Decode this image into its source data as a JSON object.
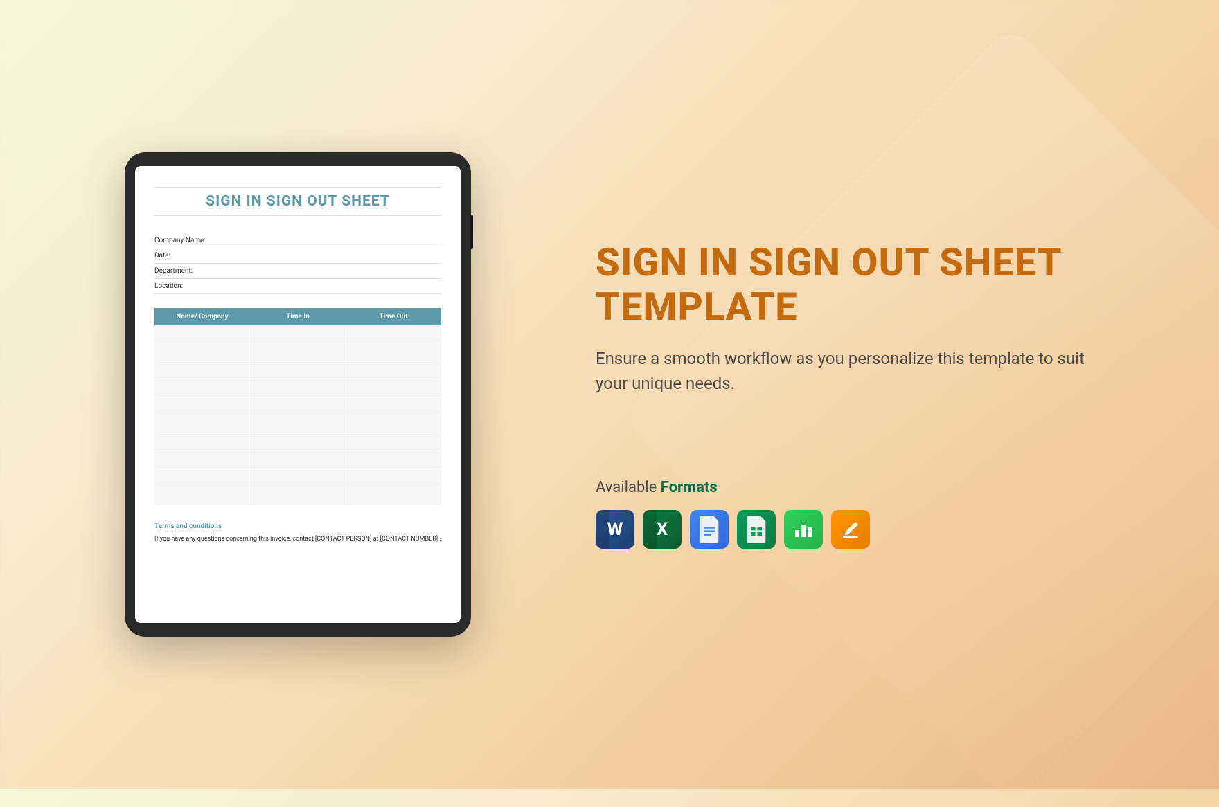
{
  "document": {
    "title": "SIGN IN SIGN OUT SHEET",
    "fields": {
      "company": "Company Name:",
      "date": "Date:",
      "department": "Department:",
      "location": "Location:"
    },
    "table": {
      "col1": "Name/ Company",
      "col2": "Time In",
      "col3": "Time Out"
    },
    "terms_title": "Terms and conditions",
    "terms_text": "If you have any questions concerning this invoice, contact [CONTACT PERSON] at [CONTACT NUMBER] ."
  },
  "promo": {
    "title": "SIGN IN SIGN OUT SHEET TEMPLATE",
    "description": "Ensure a smooth workflow as you personalize this template to suit your unique needs.",
    "formats_label_prefix": "Available ",
    "formats_label_highlight": "Formats"
  },
  "icons": {
    "word": "W",
    "excel": "X"
  }
}
